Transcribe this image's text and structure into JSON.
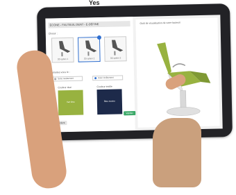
{
  "page": {
    "header_text": "Yes"
  },
  "app": {
    "title": "ÉCONE - FAUTEUIL DENT - E-DÉFINE",
    "section_label": "Choisir :",
    "options": [
      {
        "label": "3D option 1",
        "selected": false
      },
      {
        "label": "3D option 2",
        "selected": true
      },
      {
        "label": "3D option 3",
        "selected": false
      }
    ],
    "choice_label": "Souhaitez-vous le :",
    "radios": [
      {
        "label": "Sans revêtement",
        "selected": false
      },
      {
        "label": "Avec revêtement",
        "selected": true
      }
    ],
    "swatches": [
      {
        "label": "Couleur skai",
        "text": "Vert lime",
        "color": "#98b240",
        "text_color": "#ffffff"
      },
      {
        "label": "Couleur textile",
        "text": "Bleu marine",
        "color": "#1d2a4a",
        "text_color": "#ffffff"
      }
    ],
    "buttons": {
      "back": "Précédent",
      "next": "Valider"
    },
    "viewer_title": "Outil de visualisation de votre fauteuil"
  },
  "colors": {
    "accent": "#2f6fd0",
    "confirm": "#3aa867",
    "chair_seat": "#98b240",
    "chair_frame": "#ffffff"
  }
}
